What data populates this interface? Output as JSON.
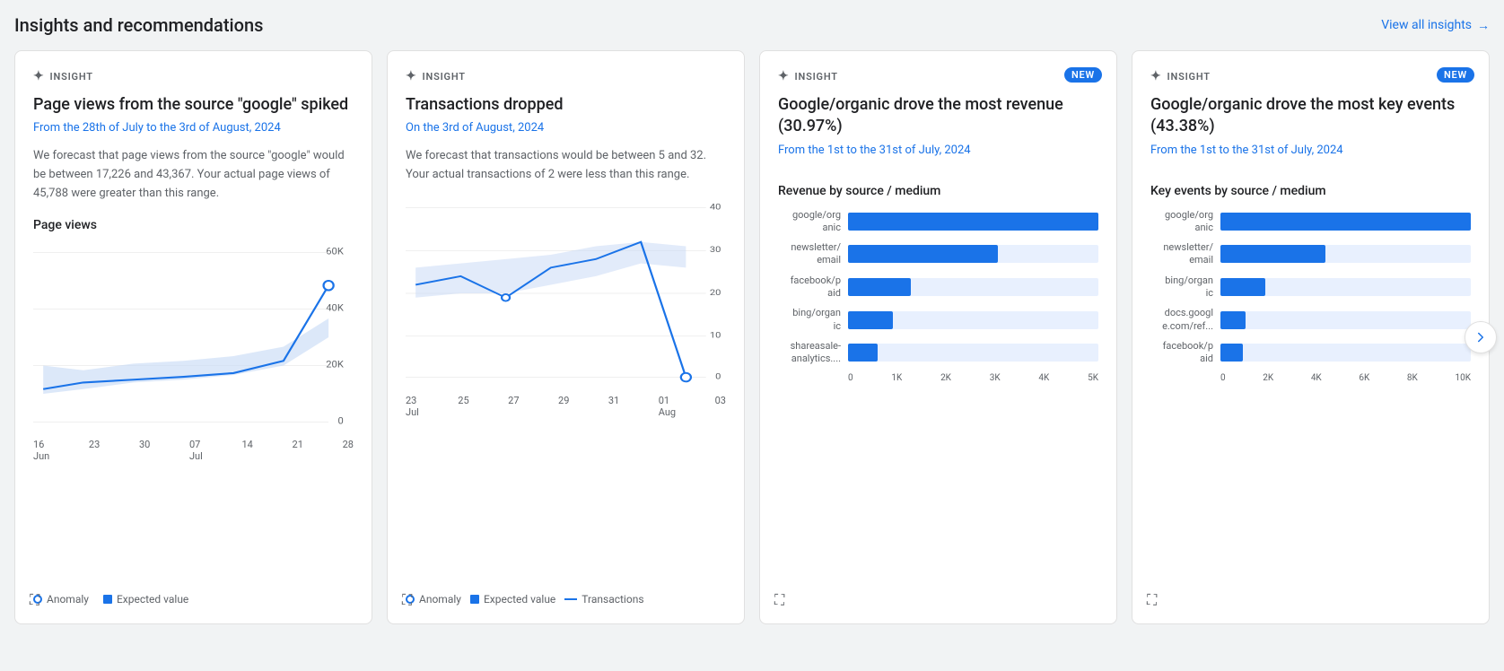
{
  "header": {
    "title": "Insights and recommendations",
    "view_all_label": "View all insights",
    "view_all_arrow": "→"
  },
  "cards": [
    {
      "id": "card1",
      "insight_label": "INSIGHT",
      "new_badge": false,
      "title": "Page views from the source \"google\" spiked",
      "subtitle": "From the 28th of July to the 3rd of August, 2024",
      "body": "We forecast that page views from the source \"google\" would be between 17,226 and 43,367. Your actual page views of 45,788 were greater than this range.",
      "chart_title": "Page views",
      "chart_type": "line",
      "x_labels": [
        "16\nJun",
        "23",
        "30",
        "07\nJul",
        "14",
        "21",
        "28"
      ],
      "y_labels": [
        "60K",
        "40K",
        "20K",
        "0"
      ],
      "legend": [
        {
          "type": "circle",
          "label": "Anomaly"
        },
        {
          "type": "square",
          "label": "Expected value"
        }
      ]
    },
    {
      "id": "card2",
      "insight_label": "INSIGHT",
      "new_badge": false,
      "title": "Transactions dropped",
      "subtitle": "On the 3rd of August, 2024",
      "body": "We forecast that transactions would be between 5 and 32. Your actual transactions of 2 were less than this range.",
      "chart_title": "",
      "chart_type": "line2",
      "x_labels": [
        "23\nJul",
        "25",
        "27",
        "29",
        "31",
        "01\nAug",
        "03"
      ],
      "y_labels": [
        "40",
        "30",
        "20",
        "10",
        "0"
      ],
      "legend": [
        {
          "type": "circle",
          "label": "Anomaly"
        },
        {
          "type": "square",
          "label": "Expected value"
        },
        {
          "type": "line",
          "label": "Transactions"
        }
      ]
    },
    {
      "id": "card3",
      "insight_label": "INSIGHT",
      "new_badge": true,
      "title": "Google/organic drove the most revenue (30.97%)",
      "subtitle": "From the 1st to the 31st of July, 2024",
      "chart_title": "Revenue by source / medium",
      "chart_type": "bar",
      "bars": [
        {
          "label": "google/org\nanic",
          "value": 100,
          "display": ""
        },
        {
          "label": "newsletter/\nemail",
          "value": 60,
          "display": ""
        },
        {
          "label": "facebook/p\naid",
          "value": 25,
          "display": ""
        },
        {
          "label": "bing/organ\nic",
          "value": 18,
          "display": ""
        },
        {
          "label": "shareasale-\nanalytics....",
          "value": 12,
          "display": ""
        }
      ],
      "axis_labels": [
        "0",
        "1K",
        "2K",
        "3K",
        "4K",
        "5K"
      ]
    },
    {
      "id": "card4",
      "insight_label": "INSIGHT",
      "new_badge": true,
      "title": "Google/organic drove the most key events (43.38%)",
      "subtitle": "From the 1st to the 31st of July, 2024",
      "chart_title": "Key events by source / medium",
      "chart_type": "bar",
      "bars": [
        {
          "label": "google/org\nanic",
          "value": 100,
          "display": ""
        },
        {
          "label": "newsletter/\nemail",
          "value": 42,
          "display": ""
        },
        {
          "label": "bing/organ\nic",
          "value": 18,
          "display": ""
        },
        {
          "label": "docs.googl\ne.com/ref...",
          "value": 10,
          "display": ""
        },
        {
          "label": "facebook/p\naid",
          "value": 9,
          "display": ""
        }
      ],
      "axis_labels": [
        "0",
        "2K",
        "4K",
        "6K",
        "8K",
        "10K"
      ]
    }
  ]
}
